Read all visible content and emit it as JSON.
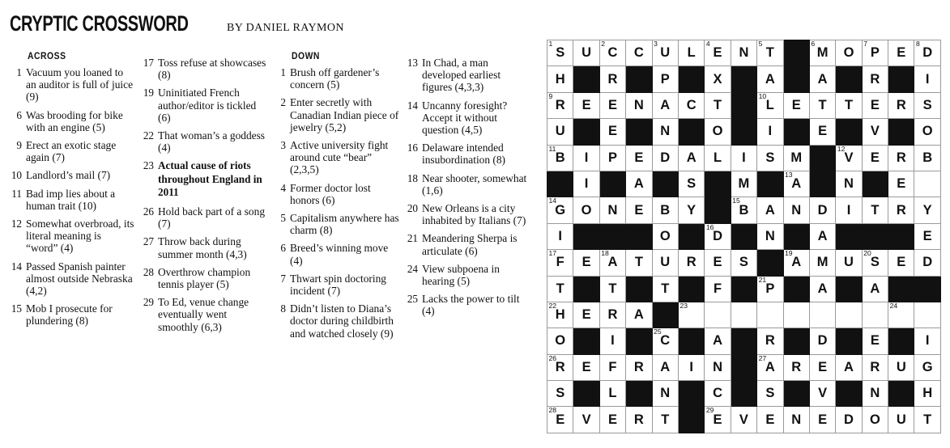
{
  "masthead": {
    "title": "CRYPTIC CROSSWORD",
    "byline": "BY DANIEL RAYMON"
  },
  "headings": {
    "across": "ACROSS",
    "down": "DOWN"
  },
  "across": [
    {
      "num": "1",
      "text": "Vacuum you loaned to an auditor is full of juice (9)"
    },
    {
      "num": "6",
      "text": "Was brooding for bike with an engine (5)"
    },
    {
      "num": "9",
      "text": "Erect an exotic stage again (7)"
    },
    {
      "num": "10",
      "text": "Landlord’s mail (7)"
    },
    {
      "num": "11",
      "text": "Bad imp lies about a human trait (10)"
    },
    {
      "num": "12",
      "text": "Somewhat overbroad, its literal meaning is “word” (4)"
    },
    {
      "num": "14",
      "text": "Passed Spanish painter almost outside Nebraska (4,2)"
    },
    {
      "num": "15",
      "text": "Mob I prosecute for plundering (8)"
    },
    {
      "num": "17",
      "text": "Toss refuse at showcases (8)"
    },
    {
      "num": "19",
      "text": "Uninitiated French author/editor is tickled (6)"
    },
    {
      "num": "22",
      "text": "That woman’s a goddess (4)"
    },
    {
      "num": "23",
      "text": "Actual cause of riots throughout England in 2011",
      "bold": true
    },
    {
      "num": "26",
      "text": "Hold back part of a song (7)"
    },
    {
      "num": "27",
      "text": "Throw back during summer month (4,3)"
    },
    {
      "num": "28",
      "text": "Overthrow champion tennis player (5)"
    },
    {
      "num": "29",
      "text": "To Ed, venue change eventually went smoothly (6,3)"
    }
  ],
  "down": [
    {
      "num": "1",
      "text": "Brush off gardener’s concern (5)"
    },
    {
      "num": "2",
      "text": "Enter secretly with Canadian Indian piece of jewelry (5,2)"
    },
    {
      "num": "3",
      "text": "Active university fight around cute “bear” (2,3,5)"
    },
    {
      "num": "4",
      "text": "Former doctor lost honors (6)"
    },
    {
      "num": "5",
      "text": "Capitalism anywhere has charm (8)"
    },
    {
      "num": "6",
      "text": "Breed’s winning move (4)"
    },
    {
      "num": "7",
      "text": "Thwart spin doctoring incident (7)"
    },
    {
      "num": "8",
      "text": "Didn’t listen to Diana’s doctor during childbirth and watched closely (9)"
    },
    {
      "num": "13",
      "text": "In Chad, a man developed earliest figures (4,3,3)"
    },
    {
      "num": "14",
      "text": "Uncanny foresight? Accept it without question (4,5)"
    },
    {
      "num": "16",
      "text": "Delaware intended insubordination (8)"
    },
    {
      "num": "18",
      "text": "Near shooter, somewhat (1,6)"
    },
    {
      "num": "20",
      "text": "New Orleans is a city inhabited by Italians (7)"
    },
    {
      "num": "21",
      "text": "Meandering Sherpa is articulate (6)"
    },
    {
      "num": "24",
      "text": "View subpoena in hearing (5)"
    },
    {
      "num": "25",
      "text": "Lacks the power to tilt (4)"
    }
  ],
  "columns": [
    {
      "heading": "ACROSS",
      "from": "across",
      "start": 0,
      "end": 8
    },
    {
      "heading": "",
      "from": "across",
      "start": 8,
      "end": 16
    },
    {
      "heading": "DOWN",
      "from": "down",
      "start": 0,
      "end": 8
    },
    {
      "heading": "",
      "from": "down",
      "start": 8,
      "end": 16
    }
  ],
  "grid": {
    "rows": 15,
    "cols": 15,
    "block_color": "#111111",
    "cell_color": "#ffffff",
    "cells": [
      [
        {
          "n": "1",
          "l": "S"
        },
        {
          "l": "U"
        },
        {
          "n": "2",
          "l": "C"
        },
        {
          "l": "C"
        },
        {
          "n": "3",
          "l": "U"
        },
        {
          "l": "L"
        },
        {
          "n": "4",
          "l": "E"
        },
        {
          "l": "N"
        },
        {
          "n": "5",
          "l": "T"
        },
        {
          "b": true
        },
        {
          "n": "6",
          "l": "M"
        },
        {
          "l": "O"
        },
        {
          "n": "7",
          "l": "P"
        },
        {
          "l": "E"
        },
        {
          "n": "8",
          "l": "D"
        }
      ],
      [
        {
          "l": "H"
        },
        {
          "b": true
        },
        {
          "l": "R"
        },
        {
          "b": true
        },
        {
          "l": "P"
        },
        {
          "b": true
        },
        {
          "l": "X"
        },
        {
          "b": true
        },
        {
          "l": "A"
        },
        {
          "b": true
        },
        {
          "l": "A"
        },
        {
          "b": true
        },
        {
          "l": "R"
        },
        {
          "b": true
        },
        {
          "l": "I"
        }
      ],
      [
        {
          "n": "9",
          "l": "R"
        },
        {
          "l": "E"
        },
        {
          "l": "E"
        },
        {
          "l": "N"
        },
        {
          "l": "A"
        },
        {
          "l": "C"
        },
        {
          "l": "T"
        },
        {
          "b": true
        },
        {
          "n": "10",
          "l": "L"
        },
        {
          "l": "E"
        },
        {
          "l": "T"
        },
        {
          "l": "T"
        },
        {
          "l": "E"
        },
        {
          "l": "R"
        },
        {
          "l": "S"
        }
      ],
      [
        {
          "l": "U"
        },
        {
          "b": true
        },
        {
          "l": "E"
        },
        {
          "b": true
        },
        {
          "l": "N"
        },
        {
          "b": true
        },
        {
          "l": "O"
        },
        {
          "b": true
        },
        {
          "l": "I"
        },
        {
          "b": true
        },
        {
          "l": "E"
        },
        {
          "b": true
        },
        {
          "l": "V"
        },
        {
          "b": true
        },
        {
          "l": "O"
        }
      ],
      [
        {
          "n": "11",
          "l": "B"
        },
        {
          "l": "I"
        },
        {
          "l": "P"
        },
        {
          "l": "E"
        },
        {
          "l": "D"
        },
        {
          "l": "A"
        },
        {
          "l": "L"
        },
        {
          "l": "I"
        },
        {
          "l": "S"
        },
        {
          "l": "M"
        },
        {
          "b": true
        },
        {
          "n": "12",
          "l": "V"
        },
        {
          "l": "E"
        },
        {
          "l": "R"
        },
        {
          "l": "B"
        }
      ],
      [
        {
          "b": true
        },
        {
          "l": "I"
        },
        {
          "b": true
        },
        {
          "l": "A"
        },
        {
          "b": true
        },
        {
          "l": "S"
        },
        {
          "b": true
        },
        {
          "l": "M"
        },
        {
          "b": true
        },
        {
          "n": "13",
          "l": "A"
        },
        {
          "b": true
        },
        {
          "l": "N"
        },
        {
          "b": true
        },
        {
          "l": "E"
        },
        {
          "x": 1
        }
      ],
      [
        {
          "n": "14",
          "l": "G"
        },
        {
          "l": "O"
        },
        {
          "l": "N"
        },
        {
          "l": "E"
        },
        {
          "l": "B"
        },
        {
          "l": "Y"
        },
        {
          "b": true
        },
        {
          "n": "15",
          "l": "B"
        },
        {
          "l": "A"
        },
        {
          "l": "N"
        },
        {
          "l": "D"
        },
        {
          "l": "I"
        },
        {
          "l": "T"
        },
        {
          "l": "R"
        },
        {
          "l": "Y"
        }
      ],
      [
        {
          "l": "I"
        },
        {
          "b": true
        },
        {
          "b": true
        },
        {
          "b": true
        },
        {
          "l": "O"
        },
        {
          "b": true
        },
        {
          "n": "16",
          "l": "D"
        },
        {
          "b": true
        },
        {
          "l": "N"
        },
        {
          "b": true
        },
        {
          "l": "A"
        },
        {
          "b": true
        },
        {
          "b": true
        },
        {
          "b": true
        },
        {
          "l": "E"
        }
      ],
      [
        {
          "n": "17",
          "l": "F"
        },
        {
          "l": "E"
        },
        {
          "n": "18",
          "l": "A"
        },
        {
          "l": "T"
        },
        {
          "l": "U"
        },
        {
          "l": "R"
        },
        {
          "l": "E"
        },
        {
          "l": "S"
        },
        {
          "b": true
        },
        {
          "n": "19",
          "l": "A"
        },
        {
          "l": "M"
        },
        {
          "l": "U"
        },
        {
          "n": "20",
          "l": "S"
        },
        {
          "l": "E"
        },
        {
          "l": "D"
        }
      ],
      [
        {
          "l": "T"
        },
        {
          "b": true
        },
        {
          "l": "T"
        },
        {
          "b": true
        },
        {
          "l": "T"
        },
        {
          "b": true
        },
        {
          "l": "F"
        },
        {
          "b": true
        },
        {
          "n": "21",
          "l": "P"
        },
        {
          "b": true
        },
        {
          "l": "A"
        },
        {
          "b": true
        },
        {
          "l": "A"
        },
        {
          "b": true
        },
        {
          "b": true
        }
      ],
      [
        {
          "n": "22",
          "l": "H"
        },
        {
          "l": "E"
        },
        {
          "l": "R"
        },
        {
          "l": "A"
        },
        {
          "b": true
        },
        {
          "n": "23",
          "l": ""
        },
        {
          "l": ""
        },
        {
          "l": ""
        },
        {
          "l": ""
        },
        {
          "l": ""
        },
        {
          "l": ""
        },
        {
          "l": ""
        },
        {
          "l": ""
        },
        {
          "n": "24",
          "l": ""
        },
        {
          "x": 1
        }
      ],
      [
        {
          "l": "O"
        },
        {
          "b": true
        },
        {
          "l": "I"
        },
        {
          "b": true
        },
        {
          "n": "25",
          "l": "C"
        },
        {
          "b": true
        },
        {
          "l": "A"
        },
        {
          "b": true
        },
        {
          "l": "R"
        },
        {
          "b": true
        },
        {
          "l": "D"
        },
        {
          "b": true
        },
        {
          "l": "E"
        },
        {
          "b": true
        },
        {
          "l": "I"
        }
      ],
      [
        {
          "n": "26",
          "l": "R"
        },
        {
          "l": "E"
        },
        {
          "l": "F"
        },
        {
          "l": "R"
        },
        {
          "l": "A"
        },
        {
          "l": "I"
        },
        {
          "l": "N"
        },
        {
          "b": true
        },
        {
          "n": "27",
          "l": "A"
        },
        {
          "l": "R"
        },
        {
          "l": "E"
        },
        {
          "l": "A"
        },
        {
          "l": "R"
        },
        {
          "l": "U"
        },
        {
          "l": "G"
        }
      ],
      [
        {
          "l": "S"
        },
        {
          "b": true
        },
        {
          "l": "L"
        },
        {
          "b": true
        },
        {
          "l": "N"
        },
        {
          "b": true
        },
        {
          "l": "C"
        },
        {
          "b": true
        },
        {
          "l": "S"
        },
        {
          "b": true
        },
        {
          "l": "V"
        },
        {
          "b": true
        },
        {
          "l": "N"
        },
        {
          "b": true
        },
        {
          "l": "H"
        }
      ],
      [
        {
          "n": "28",
          "l": "E"
        },
        {
          "l": "V"
        },
        {
          "l": "E"
        },
        {
          "l": "R"
        },
        {
          "l": "T"
        },
        {
          "b": true
        },
        {
          "n": "29",
          "l": "E"
        },
        {
          "l": "V"
        },
        {
          "l": "E"
        },
        {
          "l": "N"
        },
        {
          "l": "E"
        },
        {
          "l": "D"
        },
        {
          "l": "O"
        },
        {
          "l": "U"
        },
        {
          "l": "T"
        }
      ]
    ]
  }
}
